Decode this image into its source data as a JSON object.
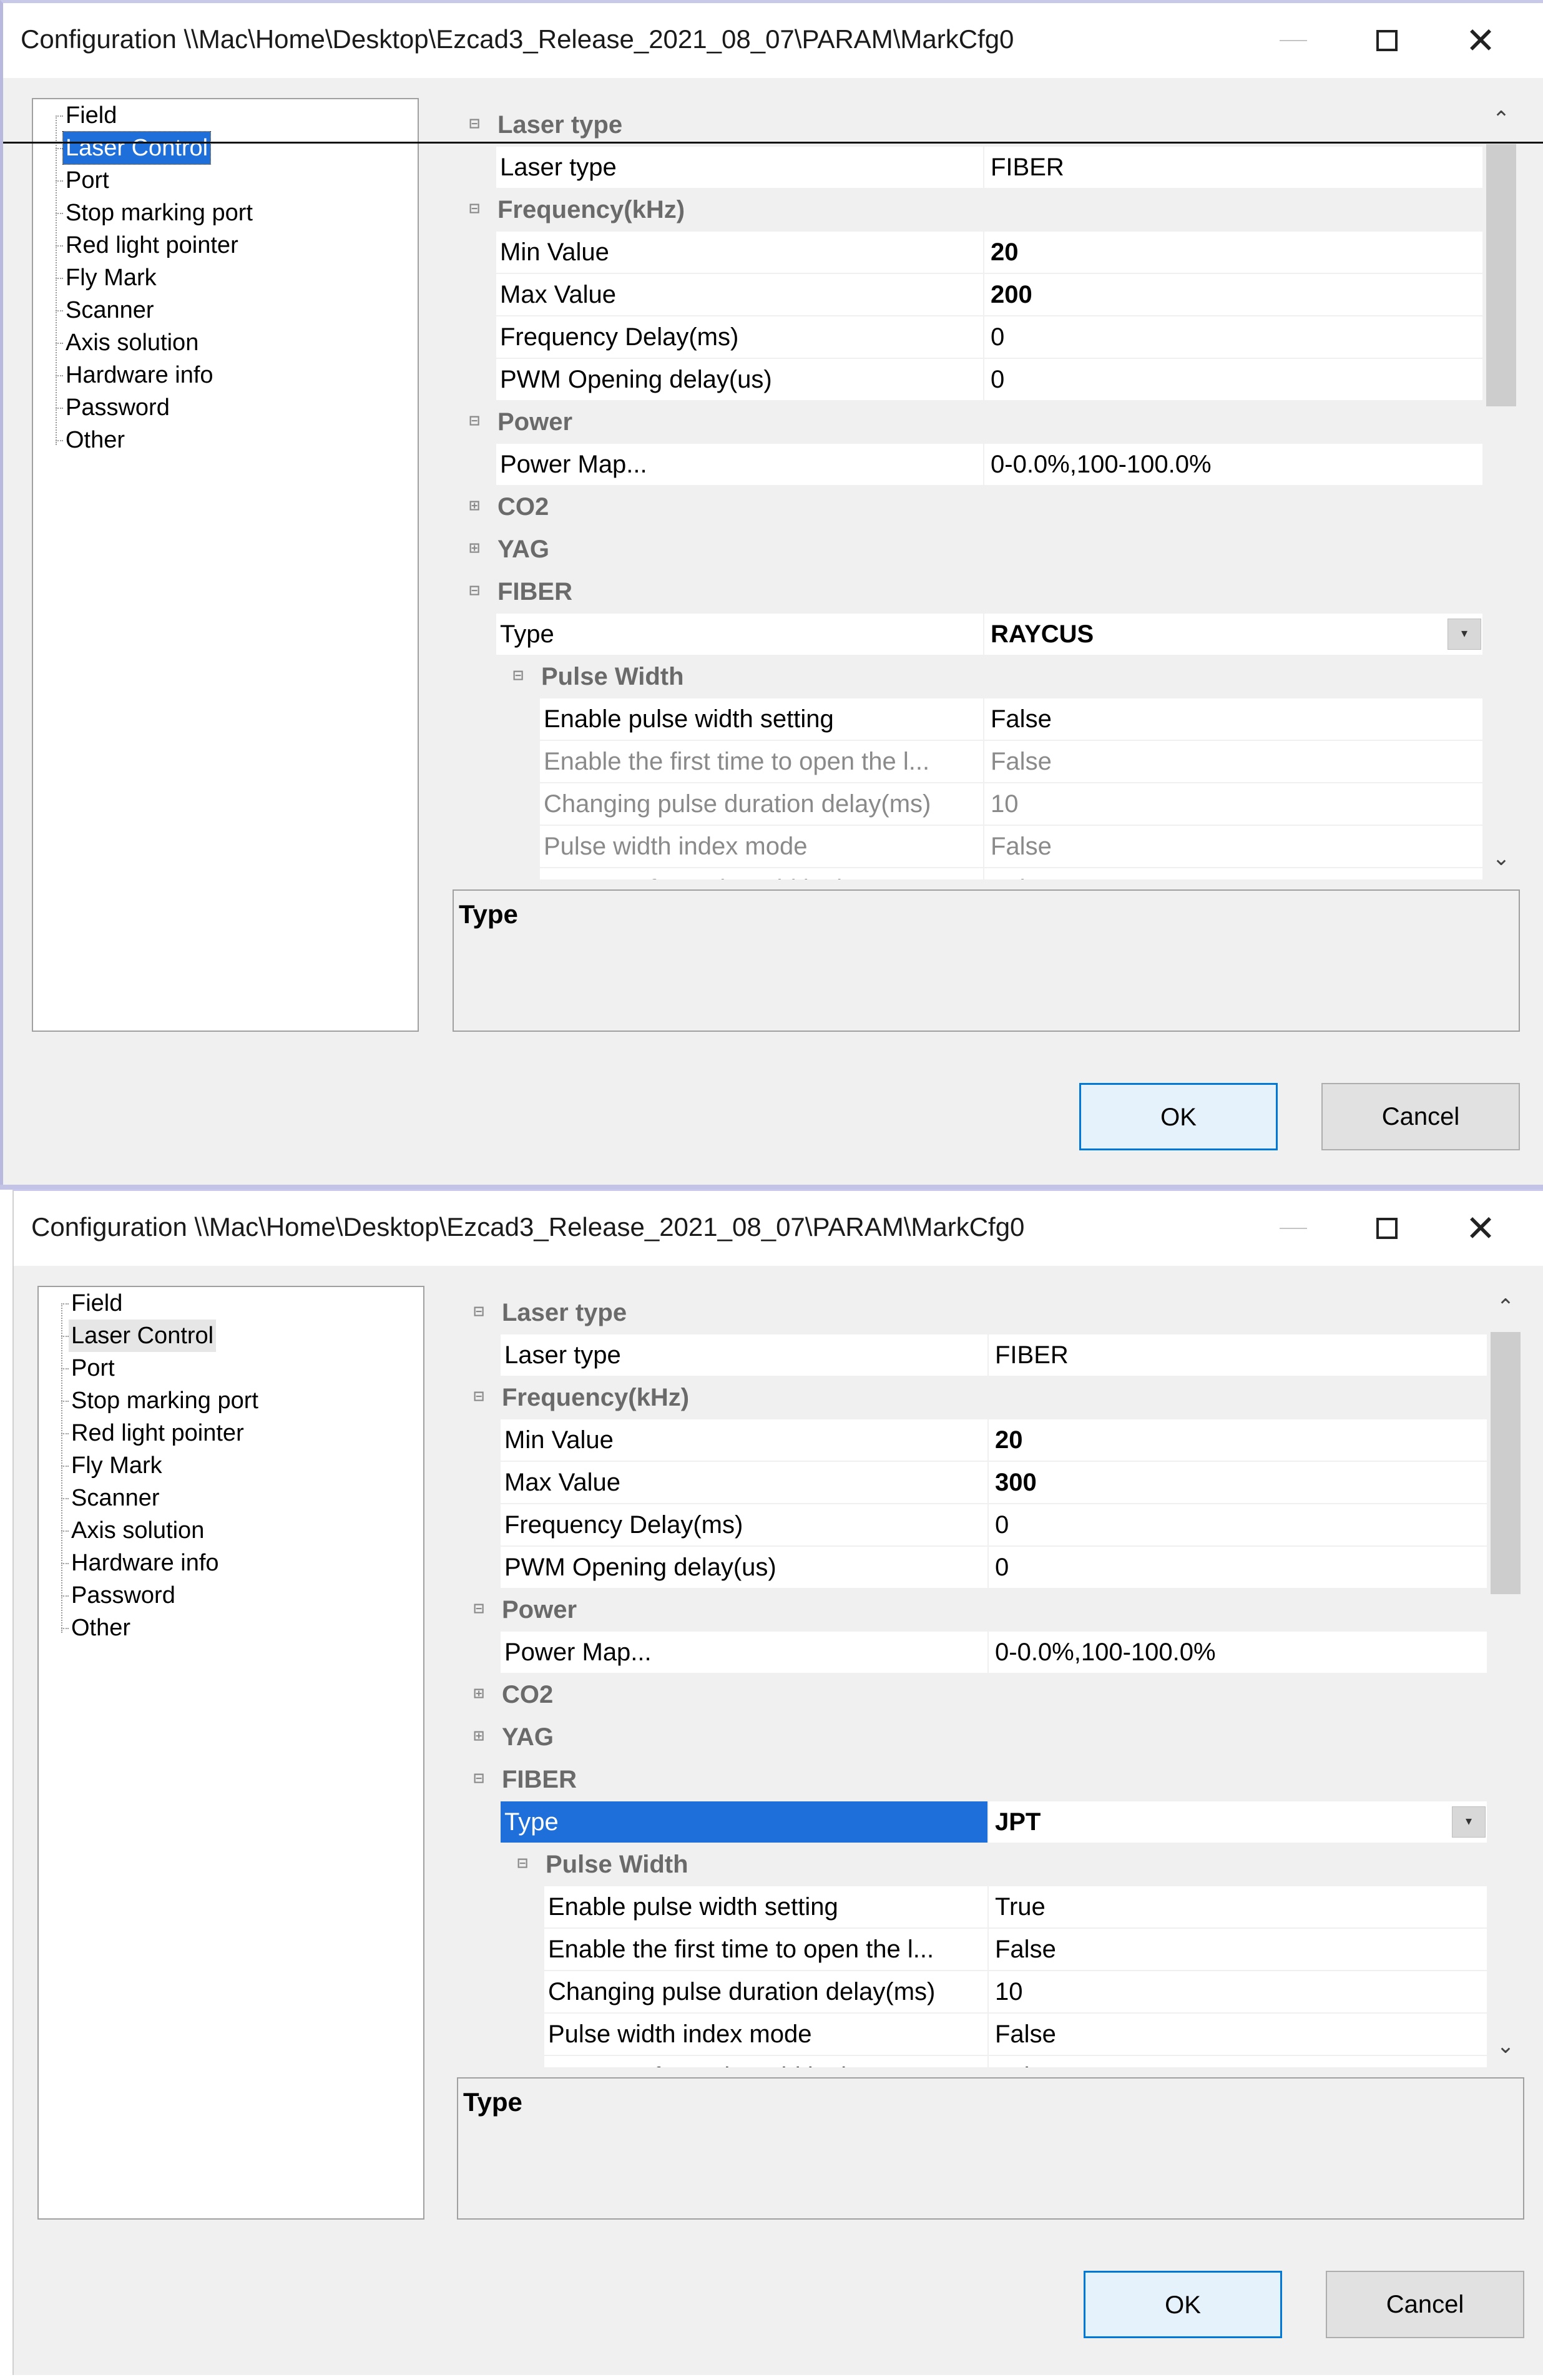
{
  "windows": [
    {
      "title": "Configuration \\\\Mac\\Home\\Desktop\\Ezcad3_Release_2021_08_07\\PARAM\\MarkCfg0",
      "tree": [
        "Field",
        "Laser Control",
        "Port",
        "Stop marking port",
        "Red light pointer",
        "Fly Mark",
        "Scanner",
        "Axis solution",
        "Hardware info",
        "Password",
        "Other"
      ],
      "selected_tree_item": "Laser Control",
      "properties": {
        "laser_type_cat": "Laser type",
        "laser_type_name": "Laser type",
        "laser_type_val": "FIBER",
        "freq_cat": "Frequency(kHz)",
        "min_name": "Min Value",
        "min_val": "20",
        "max_name": "Max Value",
        "max_val": "200",
        "freq_delay_name": "Frequency Delay(ms)",
        "freq_delay_val": "0",
        "pwm_name": "PWM Opening delay(us)",
        "pwm_val": "0",
        "power_cat": "Power",
        "power_map_name": "Power Map...",
        "power_map_val": "0-0.0%,100-100.0%",
        "co2_cat": "CO2",
        "yag_cat": "YAG",
        "fiber_cat": "FIBER",
        "type_name": "Type",
        "type_val": "RAYCUS",
        "pulse_cat": "Pulse Width",
        "enable_pw_name": "Enable pulse width setting",
        "enable_pw_val": "False",
        "first_time_name": "Enable the first time to open the l...",
        "first_time_val": "False",
        "change_delay_name": "Changing pulse duration delay(ms)",
        "change_delay_val": "10",
        "index_mode_name": "Pulse width index mode",
        "index_mode_val": "False",
        "set_mo_name": "Set MO after pulse width change",
        "set_mo_val": "False"
      },
      "description_title": "Type",
      "ok_label": "OK",
      "cancel_label": "Cancel"
    },
    {
      "title": "Configuration \\\\Mac\\Home\\Desktop\\Ezcad3_Release_2021_08_07\\PARAM\\MarkCfg0",
      "tree": [
        "Field",
        "Laser Control",
        "Port",
        "Stop marking port",
        "Red light pointer",
        "Fly Mark",
        "Scanner",
        "Axis solution",
        "Hardware info",
        "Password",
        "Other"
      ],
      "selected_tree_item": "Laser Control",
      "properties": {
        "laser_type_cat": "Laser type",
        "laser_type_name": "Laser type",
        "laser_type_val": "FIBER",
        "freq_cat": "Frequency(kHz)",
        "min_name": "Min Value",
        "min_val": "20",
        "max_name": "Max Value",
        "max_val": "300",
        "freq_delay_name": "Frequency Delay(ms)",
        "freq_delay_val": "0",
        "pwm_name": "PWM Opening delay(us)",
        "pwm_val": "0",
        "power_cat": "Power",
        "power_map_name": "Power Map...",
        "power_map_val": "0-0.0%,100-100.0%",
        "co2_cat": "CO2",
        "yag_cat": "YAG",
        "fiber_cat": "FIBER",
        "type_name": "Type",
        "type_val": "JPT",
        "pulse_cat": "Pulse Width",
        "enable_pw_name": "Enable pulse width setting",
        "enable_pw_val": "True",
        "first_time_name": "Enable the first time to open the l...",
        "first_time_val": "False",
        "change_delay_name": "Changing pulse duration delay(ms)",
        "change_delay_val": "10",
        "index_mode_name": "Pulse width index mode",
        "index_mode_val": "False",
        "set_mo_name": "Set MO after pulse width change",
        "set_mo_val": "False"
      },
      "description_title": "Type",
      "ok_label": "OK",
      "cancel_label": "Cancel"
    }
  ],
  "icons": {
    "minimize": "minimize-icon",
    "maximize": "maximize-icon",
    "close": "close-icon",
    "expanded": "expanded-icon",
    "collapsed": "collapsed-icon",
    "dropdown": "dropdown-arrow-icon",
    "scroll_up": "scroll-up-icon",
    "scroll_down": "scroll-down-icon"
  },
  "colors": {
    "selection": "#1e6fd9",
    "window_bg": "#f0f0f0",
    "ok_border": "#0078d7"
  }
}
